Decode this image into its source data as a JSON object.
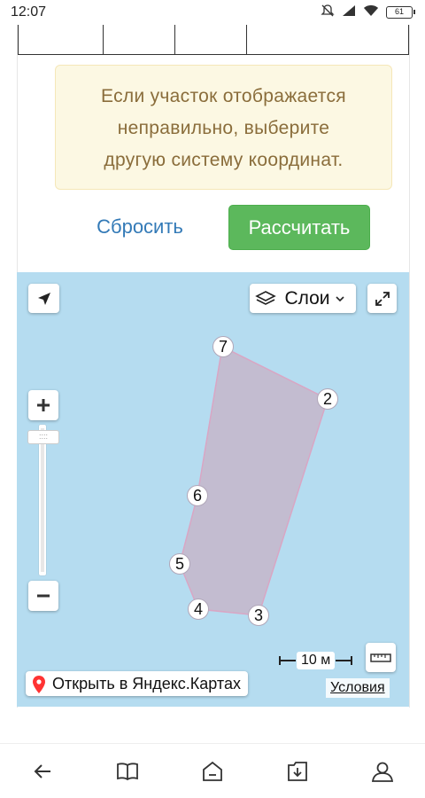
{
  "status_bar": {
    "time": "12:07",
    "battery": "61",
    "icons": [
      "mute-icon",
      "signal-icon",
      "wifi-icon",
      "battery-icon"
    ]
  },
  "alert": {
    "lines": [
      "Если участок отображается",
      "неправильно, выберите",
      "другую систему координат."
    ]
  },
  "actions": {
    "reset_label": "Сбросить",
    "calculate_label": "Рассчитать"
  },
  "map": {
    "layers_label": "Слои",
    "scale_label": "10 м",
    "open_label": "Открыть в Яндекс.Картах",
    "terms_label": "Условия",
    "vertex_labels": [
      "7",
      "2",
      "6",
      "5",
      "4",
      "3"
    ],
    "colors": {
      "water": "#b5dcf0",
      "polygon_fill": "#c4b8cc",
      "polygon_stroke": "#d9a6c4"
    }
  },
  "bottom_nav": {
    "icons": [
      "back-icon",
      "book-icon",
      "home-icon",
      "download-icon",
      "profile-icon"
    ]
  },
  "colors": {
    "accent_green": "#5cb85c",
    "link_blue": "#337ab7",
    "alert_bg": "#fcf8e3",
    "alert_text": "#8a6d3b"
  }
}
